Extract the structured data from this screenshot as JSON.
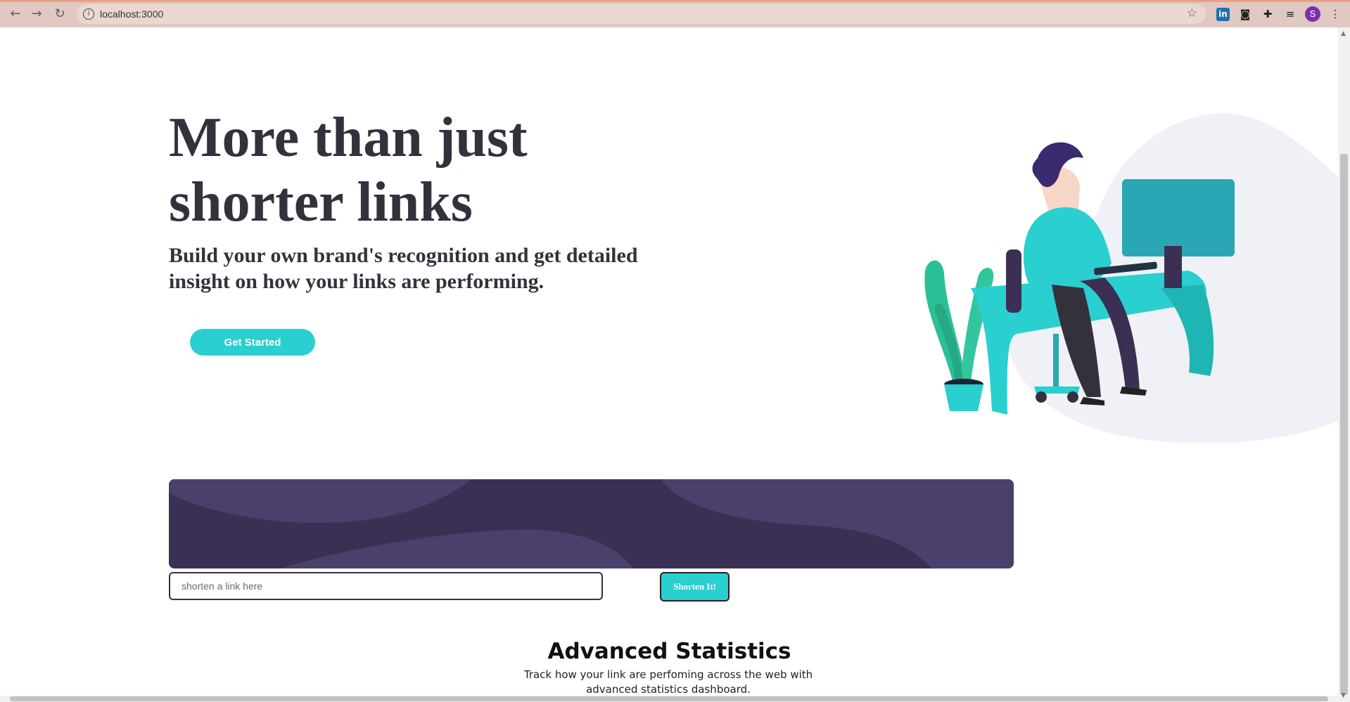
{
  "browser": {
    "url": "localhost:3000",
    "profile_initial": "S",
    "extensions": [
      "linkedin-extension-icon",
      "media-extension-icon",
      "puzzle-icon",
      "reading-list-icon"
    ]
  },
  "hero": {
    "title": "More than just shorter links",
    "subtitle": "Build your own brand's recognition and get detailed insight on how your links are performing.",
    "cta_label": "Get Started"
  },
  "shorten": {
    "placeholder": "shorten a link here",
    "button_label": "Shorten It!"
  },
  "stats": {
    "title": "Advanced Statistics",
    "description": "Track how your link are perfoming across the web with advanced statistics dashboard."
  },
  "colors": {
    "primary_cyan": "#2acfcf",
    "dark_violet": "#3b3054",
    "text_dark": "#34313d",
    "chrome_bar": "#dfc9c1"
  }
}
